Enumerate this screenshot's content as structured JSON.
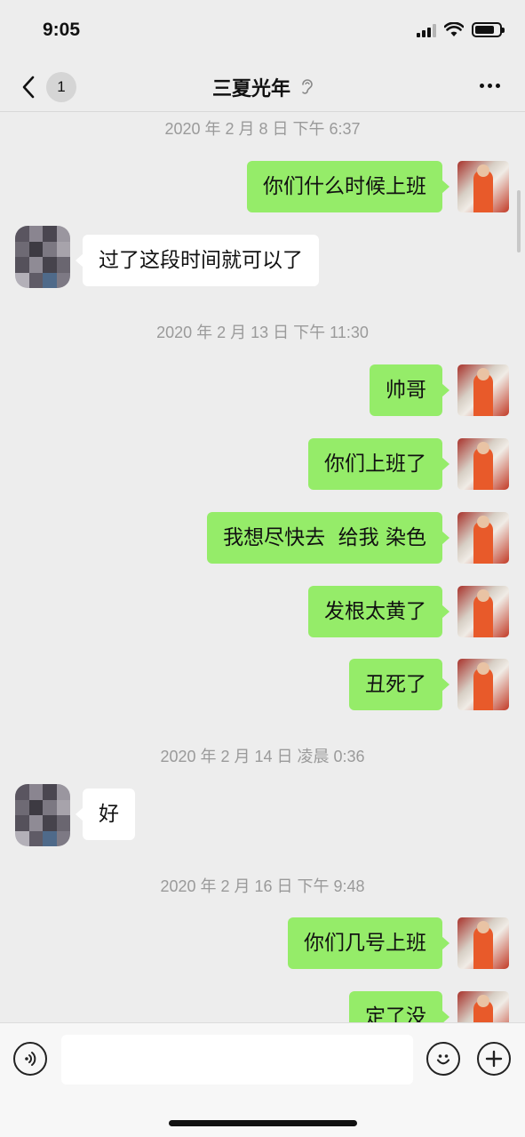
{
  "status": {
    "time": "9:05",
    "battery_level": 0.8
  },
  "nav": {
    "title": "三夏光年",
    "unread": "1"
  },
  "chat": {
    "timestamps": [
      "2020 年 2 月 8 日 下午 6:37",
      "2020 年 2 月 13 日 下午 11:30",
      "2020 年 2 月 14 日 凌晨 0:36",
      "2020 年 2 月 16 日 下午 9:48"
    ],
    "messages": [
      {
        "from": "me",
        "text": "你们什么时候上班"
      },
      {
        "from": "them",
        "text": "过了这段时间就可以了"
      },
      {
        "from": "me",
        "text": "帅哥"
      },
      {
        "from": "me",
        "text": "你们上班了"
      },
      {
        "from": "me",
        "text": "我想尽快去  给我 染色"
      },
      {
        "from": "me",
        "text": "发根太黄了"
      },
      {
        "from": "me",
        "text": "丑死了"
      },
      {
        "from": "them",
        "text": "好"
      },
      {
        "from": "me",
        "text": "你们几号上班"
      },
      {
        "from": "me",
        "text": "定了没"
      }
    ]
  },
  "colors": {
    "my_bubble": "#95ec69",
    "their_bubble": "#ffffff",
    "background": "#ededed"
  }
}
